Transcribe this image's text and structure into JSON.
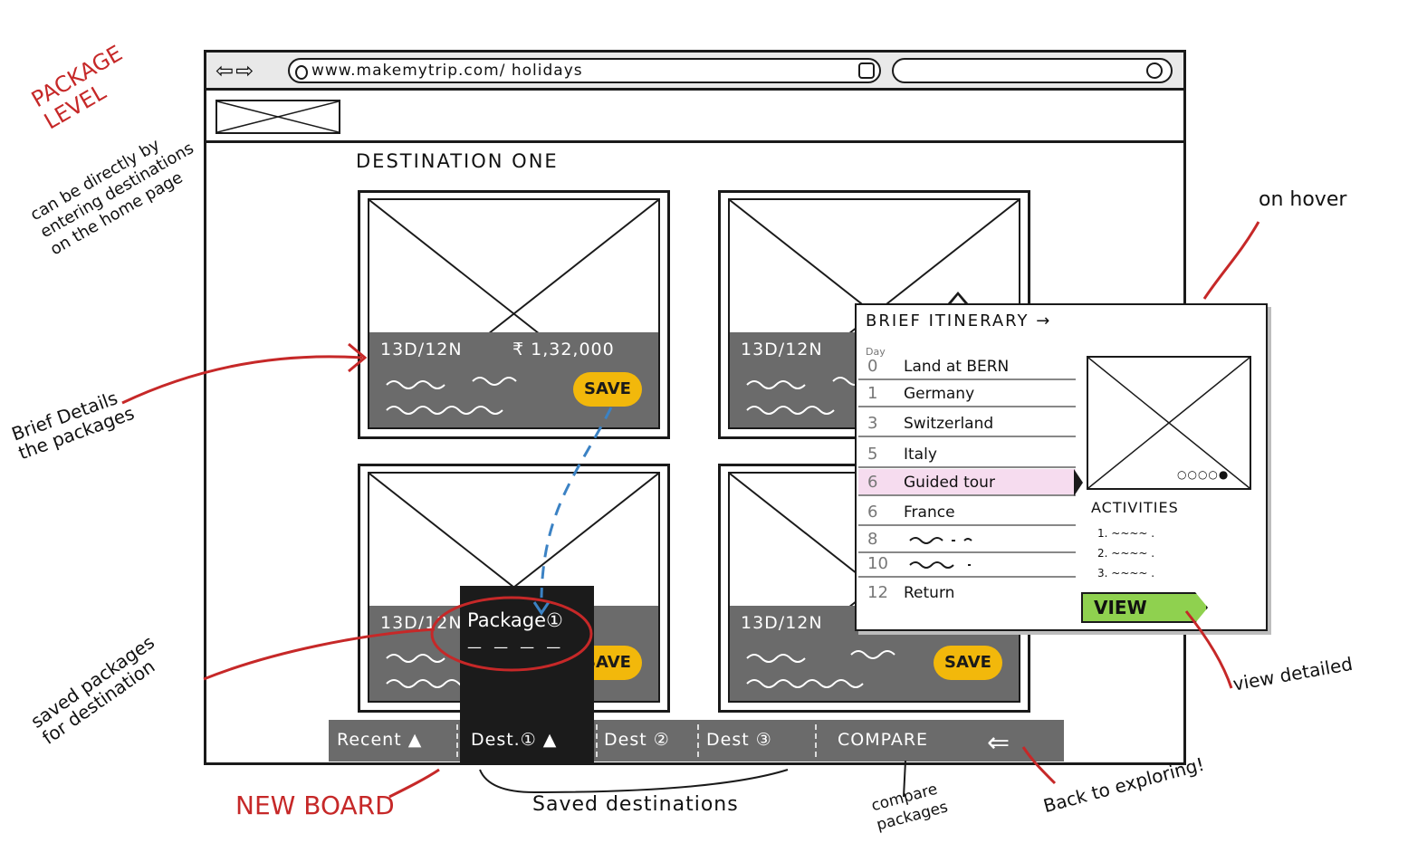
{
  "browser": {
    "url": "www.makemytrip.com/ holidays"
  },
  "page": {
    "title": "DESTINATION ONE"
  },
  "packages": [
    {
      "duration": "13D/12N",
      "price": "₹ 1,32,000",
      "save_label": "SAVE"
    },
    {
      "duration": "13D/12N",
      "price": "",
      "save_label": ""
    },
    {
      "duration": "13D/12N",
      "price": "",
      "save_label": "SAVE"
    },
    {
      "duration": "13D/12N",
      "price": "",
      "save_label": "SAVE"
    }
  ],
  "itinerary": {
    "title": "BRIEF  ITINERARY →",
    "day_header": "Day",
    "rows": [
      {
        "day": "0",
        "place": "Land at BERN"
      },
      {
        "day": "1",
        "place": "Germany"
      },
      {
        "day": "3",
        "place": "Switzerland"
      },
      {
        "day": "5",
        "place": "Italy"
      },
      {
        "day": "6",
        "place": "Guided tour"
      },
      {
        "day": "6",
        "place": "France"
      },
      {
        "day": "8",
        "place": ""
      },
      {
        "day": "10",
        "place": ""
      },
      {
        "day": "12",
        "place": "Return"
      }
    ],
    "image_dots": "○○○○●",
    "activities_title": "ACTIVITIES",
    "activities": [
      "1. ~~~~ .",
      "2. ~~~~ .",
      "3. ~~~~ ."
    ],
    "view_label": "VIEW"
  },
  "board": {
    "recent": "Recent ▲",
    "dest1": "Dest.① ▲",
    "dest2": "Dest ②",
    "dest3": "Dest ③",
    "compare": "COMPARE",
    "saved_package": "Package①"
  },
  "annotations": {
    "package_level": "PACKAGE LEVEL",
    "package_level_note": "can be directly by entering destinations on the home page",
    "on_hover": "on hover",
    "brief_details": "Brief Details the packages",
    "saved_packages": "saved packages for destination",
    "new_board": "NEW BOARD",
    "saved_destinations": "Saved destinations",
    "compare_packages": "compare packages",
    "back_to_exploring": "Back to exploring!",
    "view_detailed": "view detailed"
  },
  "colors": {
    "save": "#f2b80b",
    "view": "#8fd14f",
    "highlight": "#f6dcef",
    "annotation_red": "#c62828",
    "connector_blue": "#3b82c4"
  }
}
